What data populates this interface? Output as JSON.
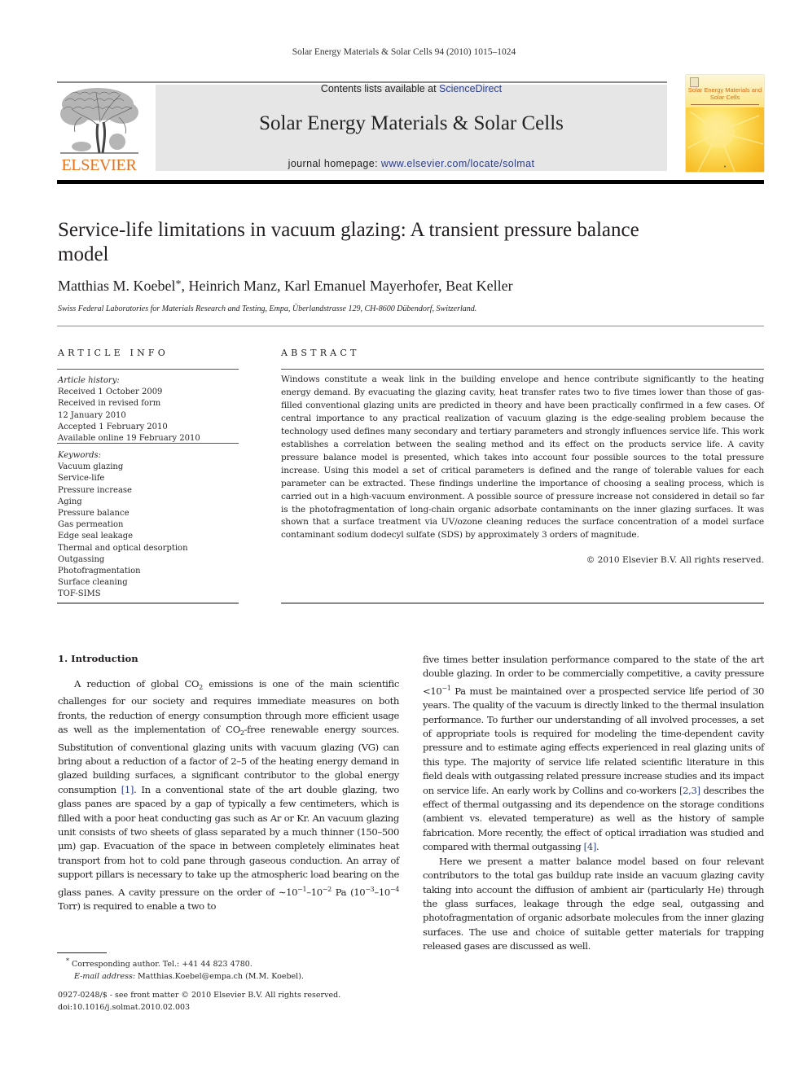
{
  "journal": {
    "running_head": "Solar Energy Materials & Solar Cells 94 (2010) 1015–1024",
    "publisher_logo_text": "ELSEVIER",
    "contents_prefix": "Contents lists available at ",
    "contents_link": "ScienceDirect",
    "title": "Solar Energy Materials & Solar Cells",
    "homepage_prefix": "journal homepage: ",
    "homepage_link": "www.elsevier.com/locate/solmat",
    "cover_title": "Solar Energy Materials and Solar Cells",
    "colors": {
      "publisher_orange": "#e9711c",
      "link_blue": "#2c3f8f",
      "banner_grey": "#e6e6e6"
    }
  },
  "article": {
    "title": "Service-life limitations in vacuum glazing: A transient pressure balance model",
    "authors": [
      {
        "name": "Matthias M. Koebel",
        "mark": "*"
      },
      {
        "name": "Heinrich Manz"
      },
      {
        "name": "Karl Emanuel Mayerhofer"
      },
      {
        "name": "Beat Keller"
      }
    ],
    "affiliation": "Swiss Federal Laboratories for Materials Research and Testing, Empa, Überlandstrasse 129, CH-8600 Dübendorf, Switzerland."
  },
  "article_info": {
    "heading": "ARTICLE INFO",
    "history_label": "Article history:",
    "history": [
      "Received 1 October 2009",
      "Received in revised form",
      "12 January 2010",
      "Accepted 1 February 2010",
      "Available online 19 February 2010"
    ],
    "keywords_label": "Keywords:",
    "keywords": [
      "Vacuum glazing",
      "Service-life",
      "Pressure increase",
      "Aging",
      "Pressure balance",
      "Gas permeation",
      "Edge seal leakage",
      "Thermal and optical desorption",
      "Outgassing",
      "Photofragmentation",
      "Surface cleaning",
      "TOF-SIMS"
    ]
  },
  "abstract": {
    "heading": "ABSTRACT",
    "text": "Windows constitute a weak link in the building envelope and hence contribute significantly to the heating energy demand. By evacuating the glazing cavity, heat transfer rates two to five times lower than those of gas-filled conventional glazing units are predicted in theory and have been practically confirmed in a few cases. Of central importance to any practical realization of vacuum glazing is the edge-sealing problem because the technology used defines many secondary and tertiary parameters and strongly influences service life. This work establishes a correlation between the sealing method and its effect on the products service life. A cavity pressure balance model is presented, which takes into account four possible sources to the total pressure increase. Using this model a set of critical parameters is defined and the range of tolerable values for each parameter can be extracted. These findings underline the importance of choosing a sealing process, which is carried out in a high-vacuum environ­ment. A possible source of pressure increase not considered in detail so far is the photofragmentation of long-chain organic adsorbate contaminants on the inner glazing surfaces. It was shown that a surface treatment via UV/ozone cleaning reduces the surface concentration of a model surface contaminant sodium dodecyl sulfate (SDS) by approximately 3 orders of magnitude.",
    "copyright": "© 2010 Elsevier B.V. All rights reserved."
  },
  "introduction": {
    "heading": "1.  Introduction",
    "p1": {
      "a": "A reduction of global CO",
      "a_sub": "2",
      "b": " emissions is one of the main scientific challenges for our society and requires immediate measures on both fronts, the reduction of energy consumption through more efficient usage as well as the implementation of CO",
      "b_sub": "2",
      "c": "-free renewable energy sources. Substitution of conventional glazing units with vacuum glazing (VG) can bring about a reduction of a factor of 2–5 of the heating energy demand in glazed building surfaces, a significant contributor to the global energy consumption ",
      "cite1": "[1]",
      "d": ". In a conventional state of the art double glazing, two glass panes are spaced by a gap of typically a few centimeters, which is filled with a poor heat conducting gas such as Ar or Kr. An vacuum glazing unit consists of two sheets of glass separated by a much thinner (150–500 μm) gap. Evacuation of the space in between completely eliminates heat transport from hot to cold pane through gaseous conduction. An array of support pillars is necessary to take up the atmospheric load bearing on the glass panes. A cavity pressure on the order of ∼10",
      "e1": "−1",
      "e_mid": "–10",
      "e2": "−2",
      "f": " Pa (10",
      "f1": "−3",
      "f_mid": "–10",
      "f2": "−4",
      "g": " Torr) is required to enable a two to five times better insulation performance compared to the state of the art double glazing. In order to be commercially competitive, a cavity pressure <10",
      "h1": "−1",
      "i": " Pa must be maintained over a prospected service life period of 30 years. The quality of the vacuum is directly linked to the thermal insulation performance. To further our understanding of all involved processes, a set of appropriate tools is required for modeling the time-dependent cavity pressure and to estimate aging effects experienced in real glazing units of this type. The majority of service life related scientific literature in this field deals with outgassing related pressure increase studies and its impact on service life. An early work by Collins and co-workers ",
      "cite2": "[2,3]",
      "j": " describes the effect of thermal outgassing and its dependence on the storage conditions (ambient vs. elevated temperature) as well as the history of sample fabrication. More recently, the effect of optical irradiation was studied and compared with thermal outgassing ",
      "cite3": "[4]",
      "k": "."
    },
    "p2": "Here we present a matter balance model based on four relevant contributors to the total gas buildup rate inside an vacuum glazing cavity taking into account the diffusion of ambient air (particularly He) through the glass surfaces, leakage through the edge seal, outgassing and photofragmentation of organic adsorbate molecules from the inner glazing surfaces. The use and choice of suitable getter materials for trapping released gases are discussed as well."
  },
  "footnotes": {
    "corresponding_mark": "*",
    "corresponding": " Corresponding author. Tel.: +41 44 823 4780.",
    "email_label": "E-mail address:",
    "email": " Matthias.Koebel@empa.ch (M.M. Koebel).",
    "issn": "0927-0248/$ - see front matter © 2010 Elsevier B.V. All rights reserved.",
    "doi": "doi:10.1016/j.solmat.2010.02.003"
  }
}
